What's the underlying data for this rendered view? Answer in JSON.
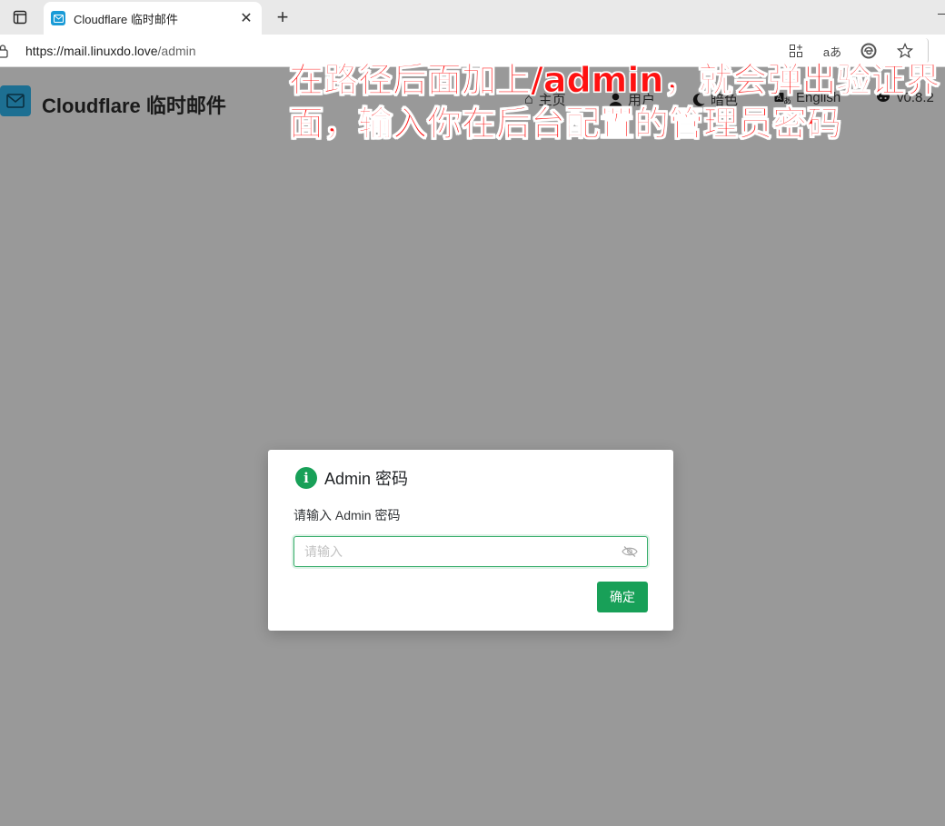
{
  "browser": {
    "tab_title": "Cloudflare 临时邮件",
    "url_host": "https://mail.linuxdo.love",
    "url_path": "/admin"
  },
  "app": {
    "title": "Cloudflare 临时邮件",
    "nav": [
      {
        "label": "主页",
        "icon": "home-icon"
      },
      {
        "label": "用户",
        "icon": "user-icon"
      },
      {
        "label": "暗色",
        "icon": "moon-icon"
      },
      {
        "label": "English",
        "icon": "translate-icon"
      },
      {
        "label": "v0.8.2",
        "icon": "github-icon"
      }
    ]
  },
  "annotation": {
    "line1": "在路径后面加上/admin，就会弹出验证界",
    "line2": "面，输入你在后台配置的管理员密码"
  },
  "dialog": {
    "title": "Admin 密码",
    "content": "请输入 Admin 密码",
    "password_placeholder": "请输入",
    "confirm_label": "确定"
  },
  "colors": {
    "accent": "#18a058",
    "overlay": "#999999",
    "annotation": "#ff1111"
  }
}
